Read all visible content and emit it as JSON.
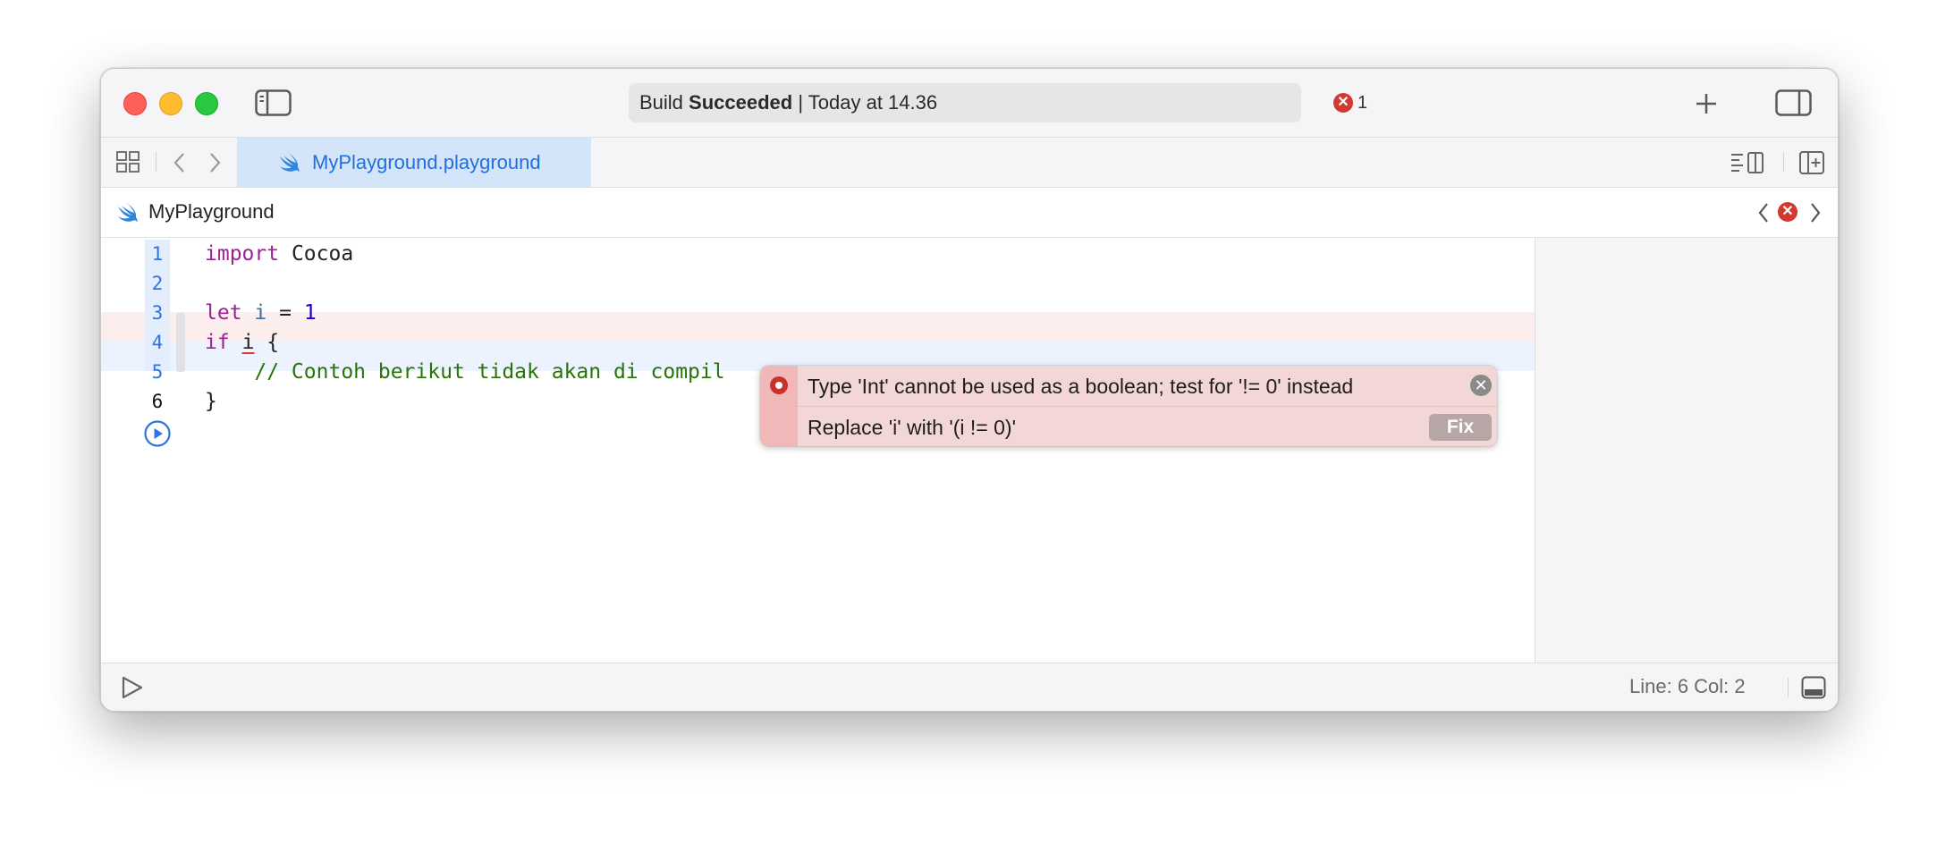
{
  "titlebar": {
    "status_prefix": "Build",
    "status_bold": "Succeeded",
    "status_suffix": "| Today at 14.36",
    "error_count": "1"
  },
  "tabbar": {
    "active_tab": "MyPlayground.playground",
    "tab_icon": "swift-icon"
  },
  "jumpbar": {
    "label": "MyPlayground",
    "issue_icon": "error-icon"
  },
  "editor": {
    "lines": [
      {
        "number": "1",
        "text": "import Cocoa"
      },
      {
        "number": "2",
        "text": ""
      },
      {
        "number": "3",
        "text": "let i = 1"
      },
      {
        "number": "4",
        "text": "if i {"
      },
      {
        "number": "5",
        "text": "    // Contoh berikut tidak akan di compil"
      },
      {
        "number": "6",
        "text": "}"
      }
    ],
    "tokens": {
      "import_kw": "import",
      "cocoa": "Cocoa",
      "let_kw": "let",
      "i_decl": "i",
      "eq": "=",
      "one": "1",
      "if_kw": "if",
      "i_use": "i",
      "brace_open": "{",
      "comment": "// Contoh berikut tidak akan di compil",
      "brace_close": "}"
    },
    "current_line": "6",
    "error_line": "4"
  },
  "error_popup": {
    "message": "Type 'Int' cannot be used as a boolean; test for '!= 0' instead",
    "fixit": "Replace 'i' with '(i != 0)'",
    "fix_label": "Fix",
    "close_glyph": "✕"
  },
  "bottombar": {
    "cursor_position": "Line: 6  Col: 2"
  },
  "colors": {
    "keyword": "#9b2393",
    "number": "#1c00cf",
    "comment": "#267507",
    "error": "#d13a2f",
    "accent": "#1f6fe0"
  }
}
